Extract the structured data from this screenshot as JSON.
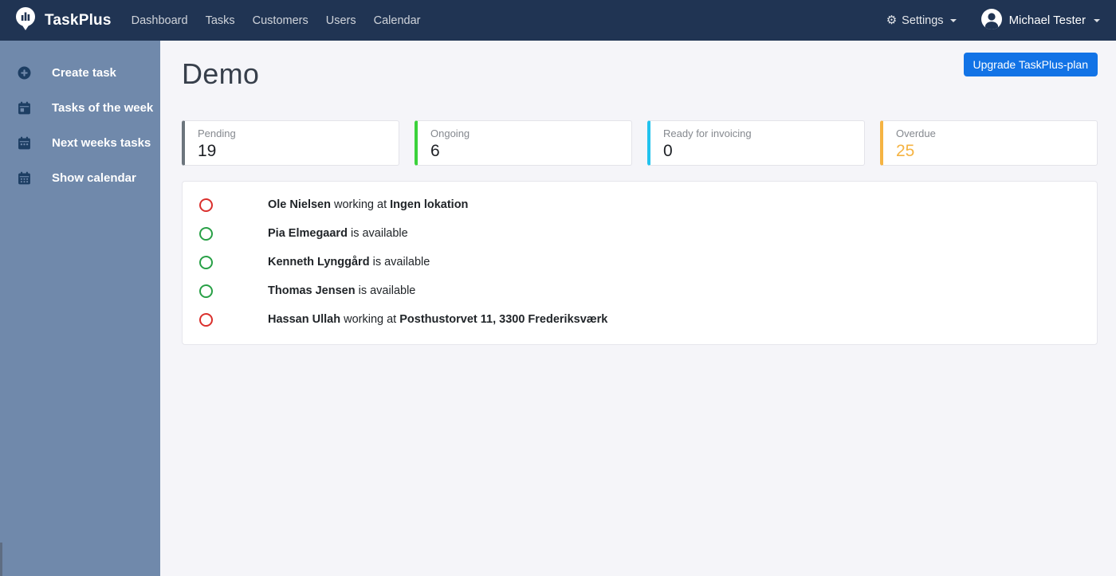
{
  "navbar": {
    "brand": "TaskPlus",
    "links": [
      {
        "label": "Dashboard"
      },
      {
        "label": "Tasks"
      },
      {
        "label": "Customers"
      },
      {
        "label": "Users"
      },
      {
        "label": "Calendar"
      }
    ],
    "settings_label": "Settings",
    "user_name": "Michael Tester"
  },
  "sidebar": {
    "items": [
      {
        "label": "Create task",
        "icon": "plus-circle-icon"
      },
      {
        "label": "Tasks of the week",
        "icon": "calendar-week-icon"
      },
      {
        "label": "Next weeks tasks",
        "icon": "calendar-next-icon"
      },
      {
        "label": "Show calendar",
        "icon": "calendar-grid-icon"
      }
    ]
  },
  "page": {
    "title": "Demo",
    "upgrade_button_label": "Upgrade TaskPlus-plan"
  },
  "stats": [
    {
      "label": "Pending",
      "value": "19",
      "accent": "#6c757d",
      "value_color": "#1d2025"
    },
    {
      "label": "Ongoing",
      "value": "6",
      "accent": "#3bd23b",
      "value_color": "#1d2025"
    },
    {
      "label": "Ready for invoicing",
      "value": "0",
      "accent": "#22c3ee",
      "value_color": "#1d2025"
    },
    {
      "label": "Overdue",
      "value": "25",
      "accent": "#f5b342",
      "value_color": "#f5b342"
    }
  ],
  "workers": [
    {
      "name": "Ole Nielsen",
      "middle": " working at ",
      "location": "Ingen lokation",
      "status": "busy",
      "status_color": "#da2f2c"
    },
    {
      "name": "Pia Elmegaard",
      "middle": " is available",
      "location": "",
      "status": "available",
      "status_color": "#28a046"
    },
    {
      "name": "Kenneth Lynggård",
      "middle": " is available",
      "location": "",
      "status": "available",
      "status_color": "#28a046"
    },
    {
      "name": "Thomas Jensen",
      "middle": " is available",
      "location": "",
      "status": "available",
      "status_color": "#28a046"
    },
    {
      "name": "Hassan Ullah",
      "middle": " working at ",
      "location": "Posthustorvet 11, 3300 Frederiksværk",
      "status": "busy",
      "status_color": "#da2f2c"
    }
  ],
  "colors": {
    "navbar_bg": "#203453",
    "sidebar_bg": "#7089ab",
    "primary_button": "#1273e6",
    "status_busy": "#da2f2c",
    "status_available": "#28a046",
    "accent_pending": "#6c757d",
    "accent_ongoing": "#3bd23b",
    "accent_invoicing": "#22c3ee",
    "accent_overdue": "#f5b342"
  }
}
